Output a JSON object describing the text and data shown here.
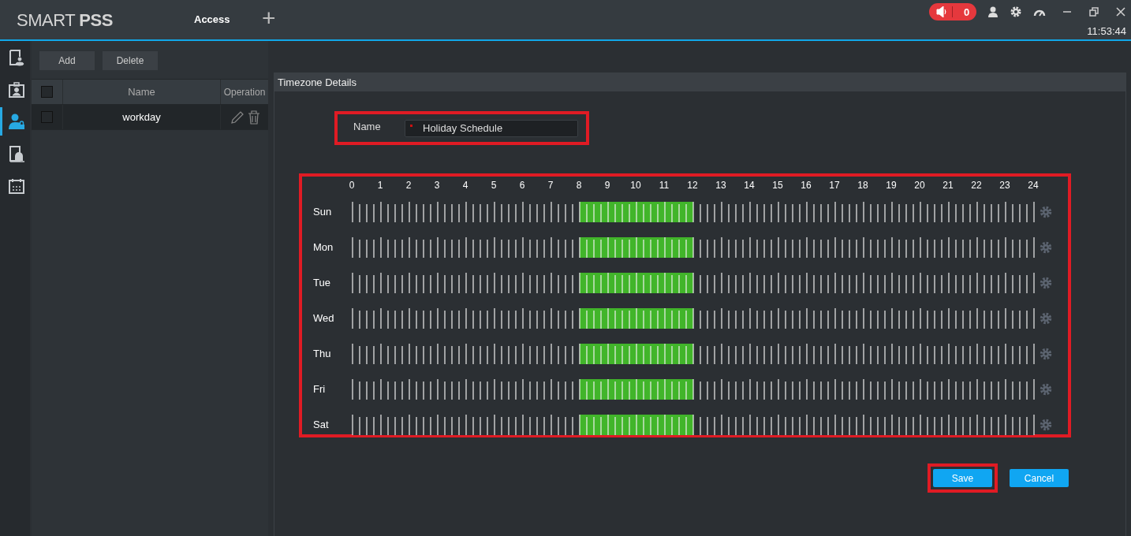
{
  "app": {
    "logo_light": "SMART ",
    "logo_bold": "PSS"
  },
  "tabs": [
    {
      "label": "Access",
      "selected": true
    }
  ],
  "add_tab": "+",
  "alarm": {
    "count": "0"
  },
  "clock": "11:53:44",
  "rail": [
    {
      "selected": false
    },
    {
      "selected": false
    },
    {
      "selected": true
    },
    {
      "selected": false
    },
    {
      "selected": false
    }
  ],
  "toolbar": [
    "Add",
    "Delete"
  ],
  "list": {
    "columns": [
      "Name",
      "Operation"
    ],
    "header_checked": false,
    "rows": [
      {
        "name": "workday",
        "checked": false,
        "selected": true
      }
    ]
  },
  "details": {
    "title": "Timezone Details",
    "name_field": {
      "label": "Name",
      "value": "Holiday Schedule",
      "required": true,
      "highlighted": true
    },
    "schedule": {
      "highlighted": true,
      "hours": [
        "0",
        "1",
        "2",
        "3",
        "4",
        "5",
        "6",
        "7",
        "8",
        "9",
        "10",
        "11",
        "12",
        "13",
        "14",
        "15",
        "16",
        "17",
        "18",
        "19",
        "20",
        "21",
        "22",
        "23",
        "24"
      ],
      "days": [
        {
          "label": "Sun",
          "active_hours": [
            false,
            false,
            false,
            false,
            false,
            false,
            false,
            false,
            true,
            true,
            true,
            true,
            false,
            false,
            false,
            false,
            false,
            false,
            false,
            false,
            false,
            false,
            false,
            false
          ]
        },
        {
          "label": "Mon",
          "active_hours": [
            false,
            false,
            false,
            false,
            false,
            false,
            false,
            false,
            true,
            true,
            true,
            true,
            false,
            false,
            false,
            false,
            false,
            false,
            false,
            false,
            false,
            false,
            false,
            false
          ]
        },
        {
          "label": "Tue",
          "active_hours": [
            false,
            false,
            false,
            false,
            false,
            false,
            false,
            false,
            true,
            true,
            true,
            true,
            false,
            false,
            false,
            false,
            false,
            false,
            false,
            false,
            false,
            false,
            false,
            false
          ]
        },
        {
          "label": "Wed",
          "active_hours": [
            false,
            false,
            false,
            false,
            false,
            false,
            false,
            false,
            true,
            true,
            true,
            true,
            false,
            false,
            false,
            false,
            false,
            false,
            false,
            false,
            false,
            false,
            false,
            false
          ]
        },
        {
          "label": "Thu",
          "active_hours": [
            false,
            false,
            false,
            false,
            false,
            false,
            false,
            false,
            true,
            true,
            true,
            true,
            false,
            false,
            false,
            false,
            false,
            false,
            false,
            false,
            false,
            false,
            false,
            false
          ]
        },
        {
          "label": "Fri",
          "active_hours": [
            false,
            false,
            false,
            false,
            false,
            false,
            false,
            false,
            true,
            true,
            true,
            true,
            false,
            false,
            false,
            false,
            false,
            false,
            false,
            false,
            false,
            false,
            false,
            false
          ]
        },
        {
          "label": "Sat",
          "active_hours": [
            false,
            false,
            false,
            false,
            false,
            false,
            false,
            false,
            true,
            true,
            true,
            true,
            false,
            false,
            false,
            false,
            false,
            false,
            false,
            false,
            false,
            false,
            false,
            false
          ]
        }
      ]
    },
    "buttons": [
      {
        "label": "Save",
        "highlighted": true
      },
      {
        "label": "Cancel",
        "highlighted": false
      }
    ]
  }
}
